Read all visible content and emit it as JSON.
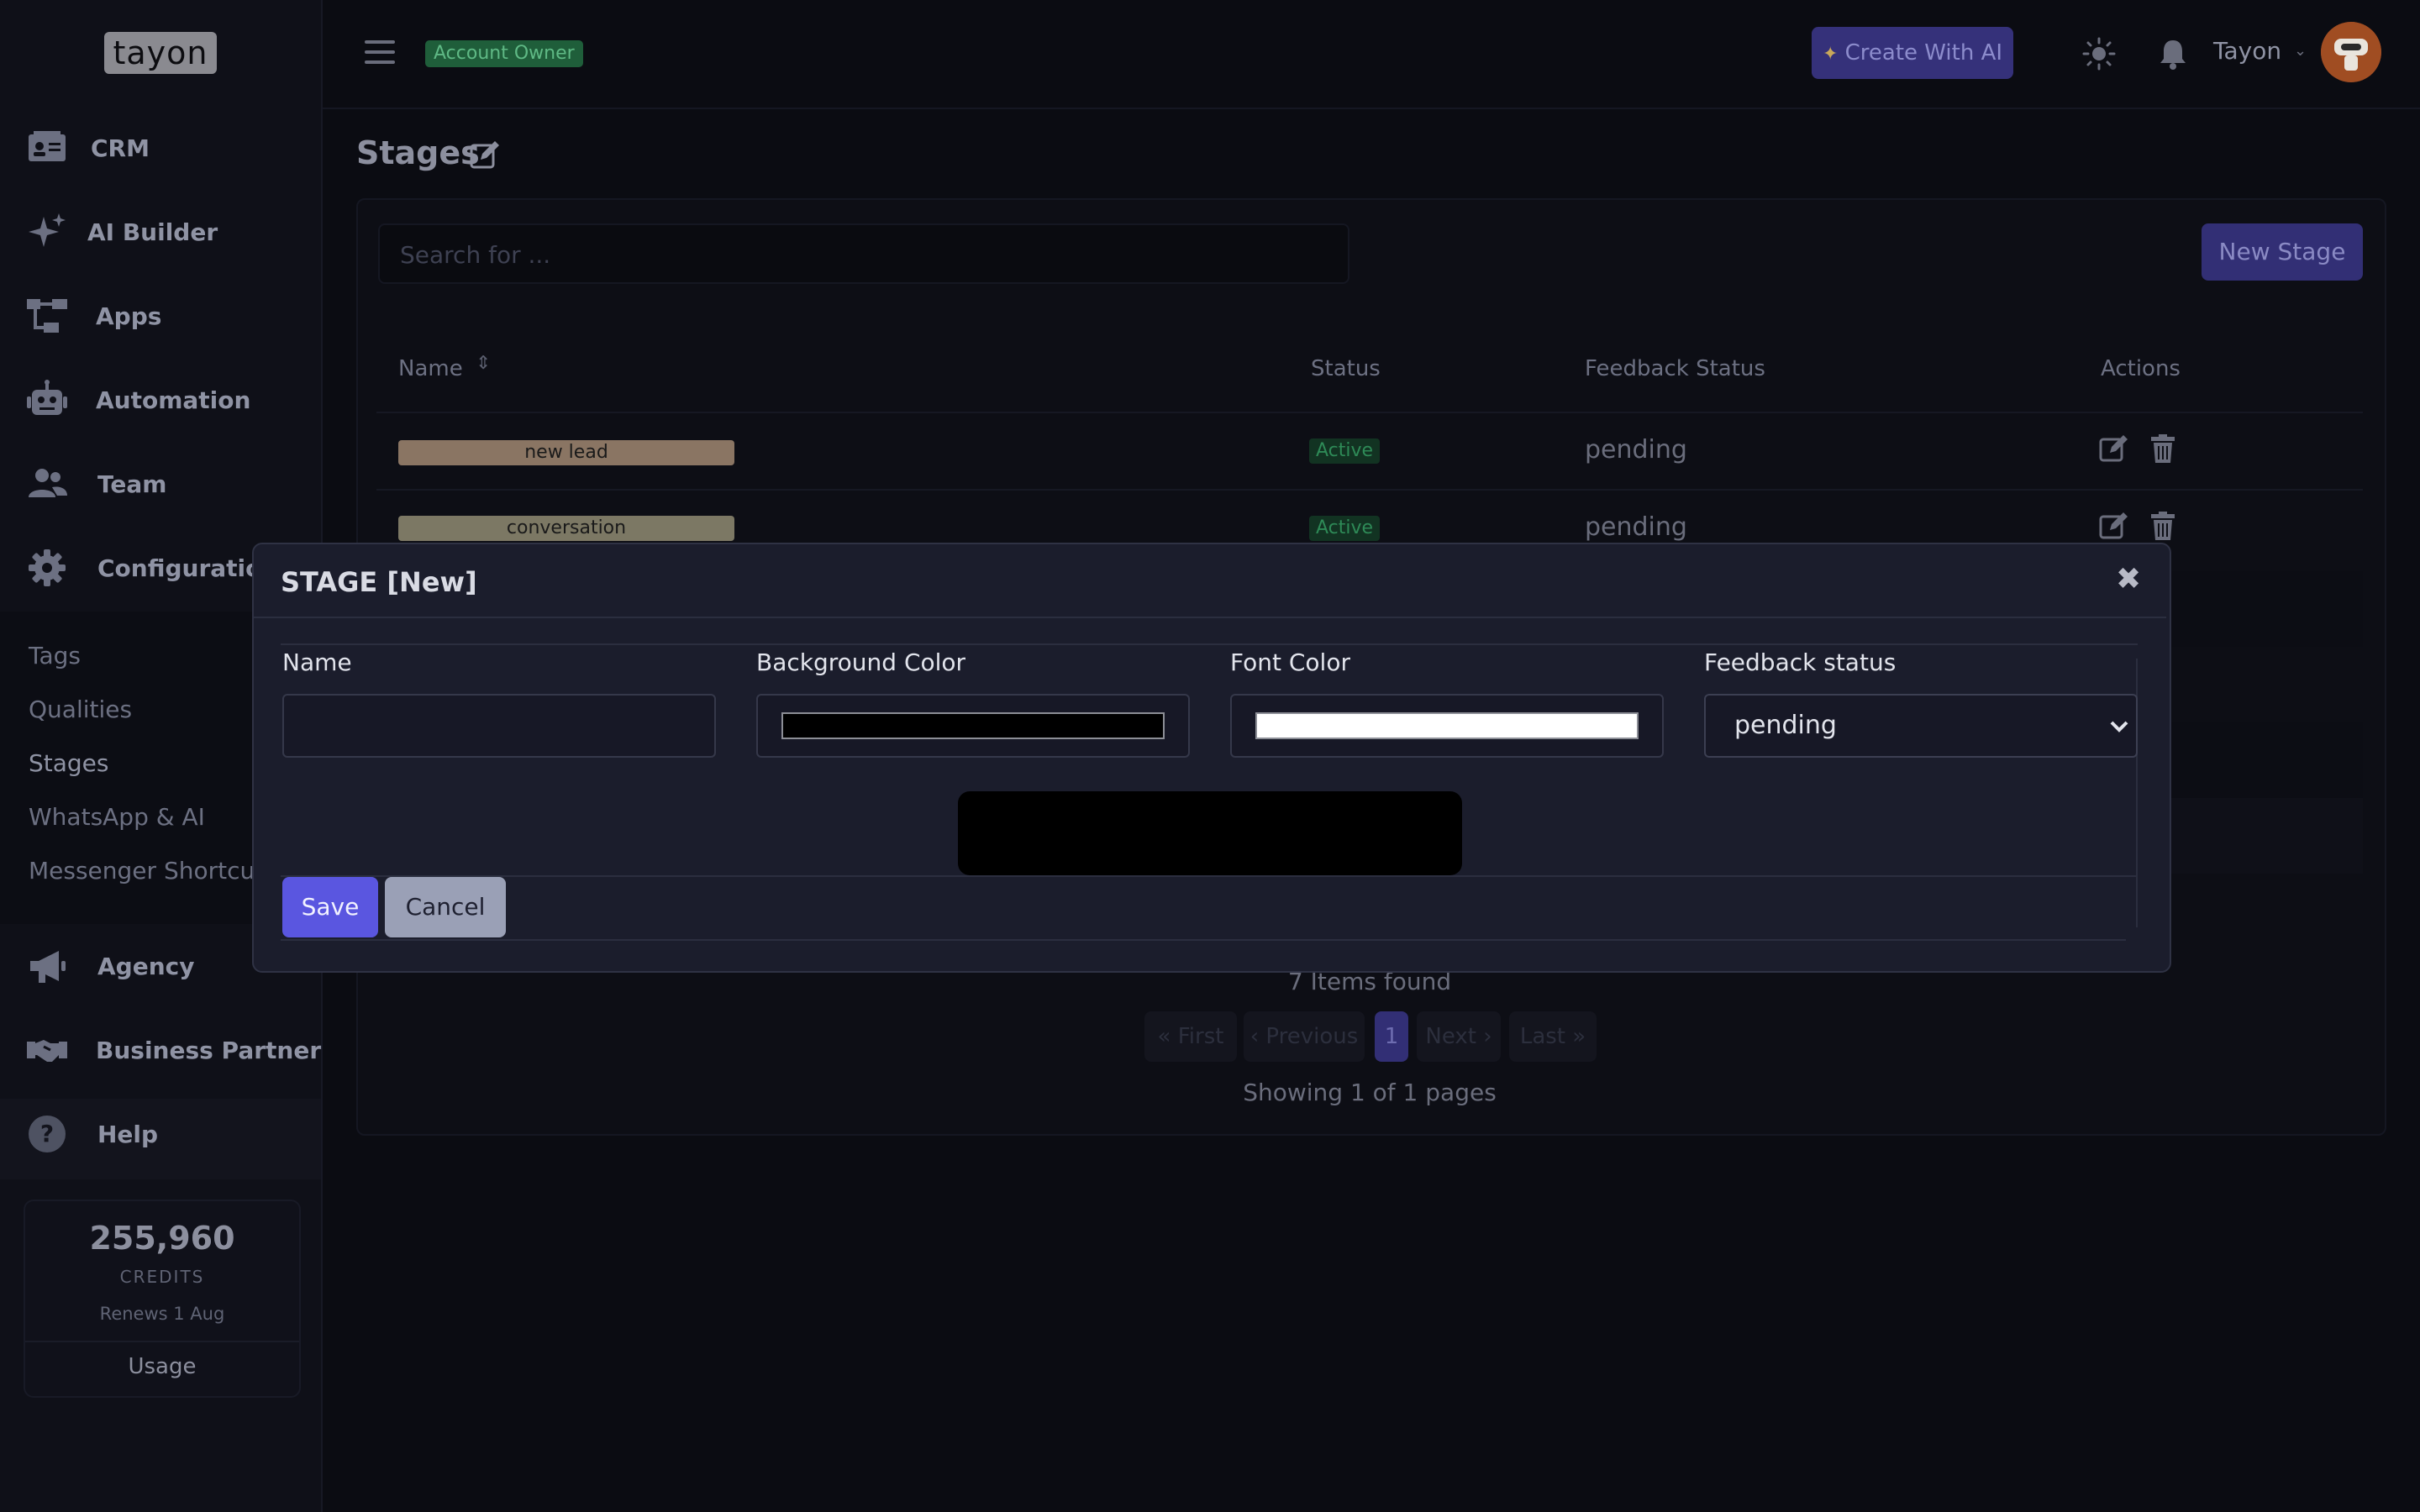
{
  "brand": {
    "logo_text": "tayon"
  },
  "sidebar": {
    "items": [
      {
        "label": "CRM",
        "icon": "id-card-icon"
      },
      {
        "label": "AI Builder",
        "icon": "sparkles-icon"
      },
      {
        "label": "Apps",
        "icon": "sitemap-icon"
      },
      {
        "label": "Automation",
        "icon": "robot-icon"
      },
      {
        "label": "Team",
        "icon": "users-icon"
      },
      {
        "label": "Configuration",
        "icon": "gear-icon"
      }
    ],
    "subitems": [
      "Tags",
      "Qualities",
      "Stages",
      "WhatsApp & AI",
      "Messenger Shortcuts"
    ],
    "items2": [
      {
        "label": "Agency",
        "icon": "megaphone-icon"
      },
      {
        "label": "Business Partner",
        "icon": "handshake-icon"
      },
      {
        "label": "Help",
        "icon": "question-icon"
      }
    ],
    "credits": {
      "value": "255,960",
      "caption": "CREDITS",
      "renews": "Renews 1 Aug",
      "usage_label": "Usage"
    }
  },
  "header": {
    "role_badge": "Account Owner",
    "ai_button": "Create With AI",
    "user_name": "Tayon"
  },
  "page": {
    "title": "Stages",
    "search_placeholder": "Search for ...",
    "new_button": "New Stage",
    "columns": [
      "Name",
      "Status",
      "Feedback Status",
      "Actions"
    ],
    "rows": [
      {
        "name": "new lead",
        "pill_color": "#8a7563",
        "status": "Active",
        "feedback": "pending"
      },
      {
        "name": "conversation",
        "pill_color": "#7c7864",
        "status": "Active",
        "feedback": "pending"
      }
    ],
    "items_found": "7 Items found",
    "pagination": {
      "first": "« First",
      "previous": "‹ Previous",
      "current": "1",
      "next": "Next ›",
      "last": "Last »"
    },
    "pages_info": "Showing 1 of 1 pages"
  },
  "modal": {
    "title": "STAGE [New]",
    "close_glyph": "✖",
    "fields": {
      "name_label": "Name",
      "name_value": "",
      "bg_label": "Background Color",
      "bg_value": "#000000",
      "font_label": "Font Color",
      "font_value": "#ffffff",
      "feedback_label": "Feedback status",
      "feedback_value": "pending"
    },
    "preview_text": "",
    "save_label": "Save",
    "cancel_label": "Cancel"
  }
}
